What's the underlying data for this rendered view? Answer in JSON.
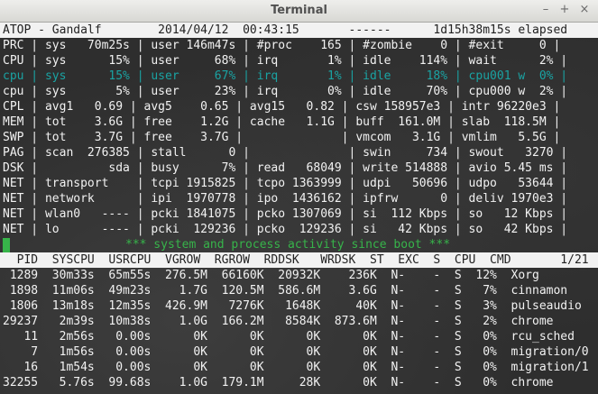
{
  "window": {
    "title": "Terminal",
    "buttons": {
      "minimize": "–",
      "maximize": "+",
      "close": "×"
    }
  },
  "header": {
    "line": "ATOP - Gandalf        2014/04/12  00:43:15       ------      1d15h38m15s elapsed"
  },
  "stats_rows": [
    "PRC | sys   70m25s | user 146m47s | #proc    165 | #zombie    0 | #exit     0 |",
    "CPU | sys      15% | user     68% | irq       1% | idle    114% | wait      2% |",
    "cpu | sys      15% | user     67% | irq       1% | idle     18% | cpu001 w  0% |",
    "cpu | sys       5% | user     23% | irq       0% | idle     70% | cpu000 w  2% |",
    "CPL | avg1   0.69 | avg5    0.65 | avg15   0.82 | csw 158957e3 | intr 96220e3 |",
    "MEM | tot    3.6G | free    1.2G | cache   1.1G | buff  161.0M | slab  118.5M |",
    "SWP | tot    3.7G | free    3.7G |              | vmcom   3.1G | vmlim   5.5G |",
    "PAG | scan  276385 | stall      0 |              | swin     734 | swout   3270 |",
    "DSK |          sda | busy      7% | read   68049 | write 514888 | avio 5.45 ms |",
    "NET | transport    | tcpi 1915825 | tcpo 1363999 | udpi   50696 | udpo   53644 |",
    "NET | network      | ipi  1970778 | ipo  1436162 | ipfrw      0 | deliv 1970e3 |",
    "NET | wlan0   ---- | pcki 1841075 | pcko 1307069 | si  112 Kbps | so   12 Kbps |",
    "NET | lo      ---- | pcki  129236 | pcko  129236 | si   42 Kbps | so   42 Kbps |"
  ],
  "activity_line": "*** system and process activity since boot ***",
  "table": {
    "header": "  PID  SYSCPU  USRCPU  VGROW  RGROW  RDDSK   WRDSK  ST  EXC  S  CPU  CMD       1/21",
    "rows": [
      " 1289  30m33s  65m55s  276.5M  66160K  20932K    236K  N-    -  S  12%  Xorg",
      " 1898  11m06s  49m23s    1.7G  120.5M  586.6M    3.6G  N-    -  S   7%  cinnamon",
      " 1806  13m18s  12m35s  426.9M   7276K   1648K     40K  N-    -  S   3%  pulseaudio",
      "29237   2m39s  10m38s    1.0G  166.2M   8584K  873.6M  N-    -  S   2%  chrome",
      "   11   2m56s   0.00s      0K      0K      0K      0K  N-    -  S   0%  rcu_sched",
      "    7   1m56s   0.00s      0K      0K      0K      0K  N-    -  S   0%  migration/0",
      "   16   1m54s   0.00s      0K      0K      0K      0K  N-    -  S   0%  migration/1",
      "32255   5.76s  99.68s    1.0G  179.1M     28K      0K  N-    -  S   0%  chrome"
    ]
  },
  "colors": {
    "teal": "#1aa3a3",
    "green": "#37b44a",
    "foreground": "#f2f2f2",
    "background": "#2e2e2e"
  }
}
